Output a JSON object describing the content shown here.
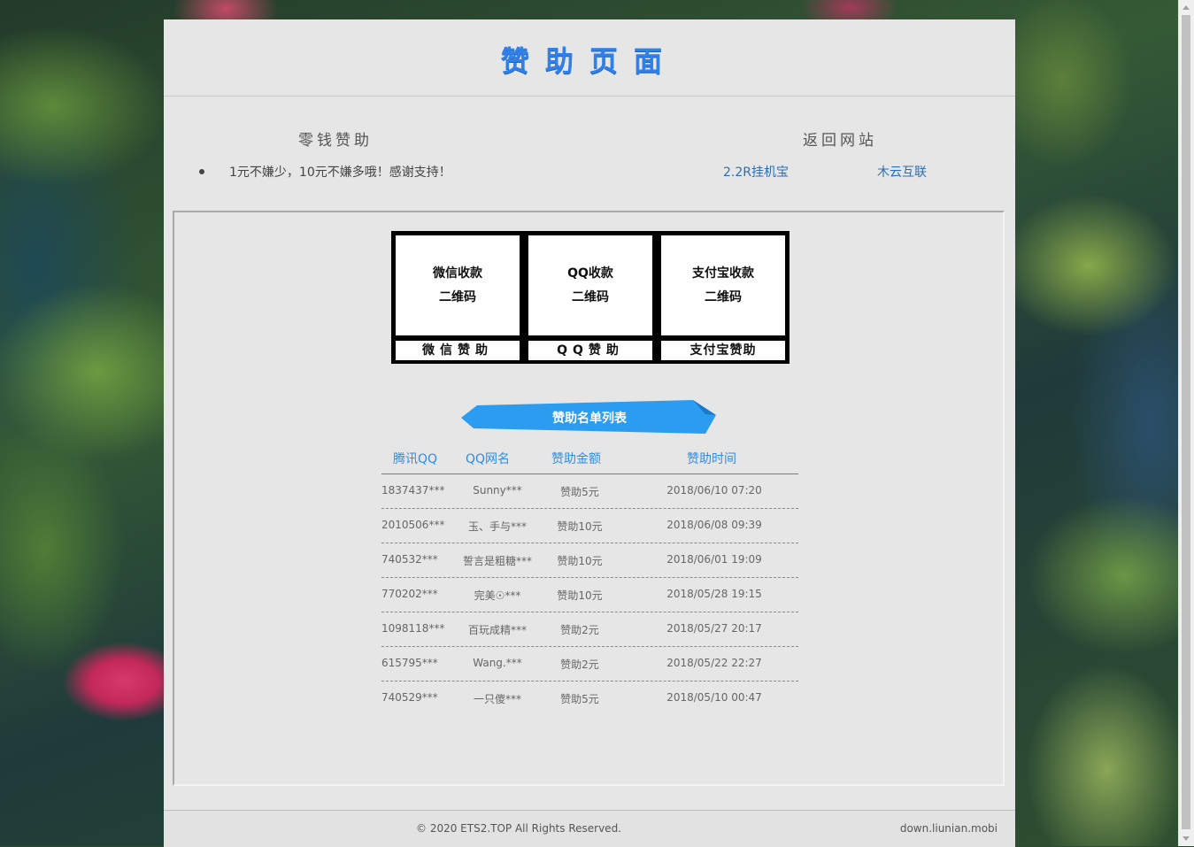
{
  "header": {
    "title": "赞助页面"
  },
  "left": {
    "title": "零钱赞助",
    "note": "1元不嫌少，10元不嫌多哦！感谢支持！"
  },
  "right": {
    "title": "返回网站",
    "links": [
      "2.2R挂机宝",
      "木云互联"
    ]
  },
  "qr": [
    {
      "line1": "微信收款",
      "line2": "二维码",
      "label": "微信赞助"
    },
    {
      "line1": "QQ收款",
      "line2": "二维码",
      "label": "QQ赞助"
    },
    {
      "line1": "支付宝收款",
      "line2": "二维码",
      "label": "支付宝赞助"
    }
  ],
  "banner": "赞助名单列表",
  "table": {
    "headers": [
      "腾讯QQ",
      "QQ网名",
      "赞助金额",
      "赞助时间"
    ],
    "rows": [
      [
        "1837437***",
        "Sunny***",
        "赞助5元",
        "2018/06/10 07:20"
      ],
      [
        "2010506***",
        "玉、手与***",
        "赞助10元",
        "2018/06/08 09:39"
      ],
      [
        "740532***",
        "誓言是粗糖***",
        "赞助10元",
        "2018/06/01 19:09"
      ],
      [
        "770202***",
        "完美☉***",
        "赞助10元",
        "2018/05/28 19:15"
      ],
      [
        "1098118***",
        "百玩成精***",
        "赞助2元",
        "2018/05/27 20:17"
      ],
      [
        "615795***",
        "Wang.***",
        "赞助2元",
        "2018/05/22 22:27"
      ],
      [
        "740529***",
        "一只傻***",
        "赞助5元",
        "2018/05/10 00:47"
      ]
    ]
  },
  "footer": {
    "copyright": "© 2020 ETS2.TOP All Rights Reserved.",
    "domain": "down.liunian.mobi"
  },
  "colors": {
    "accent": "#2f80e8",
    "banner": "#2b9cf0"
  }
}
